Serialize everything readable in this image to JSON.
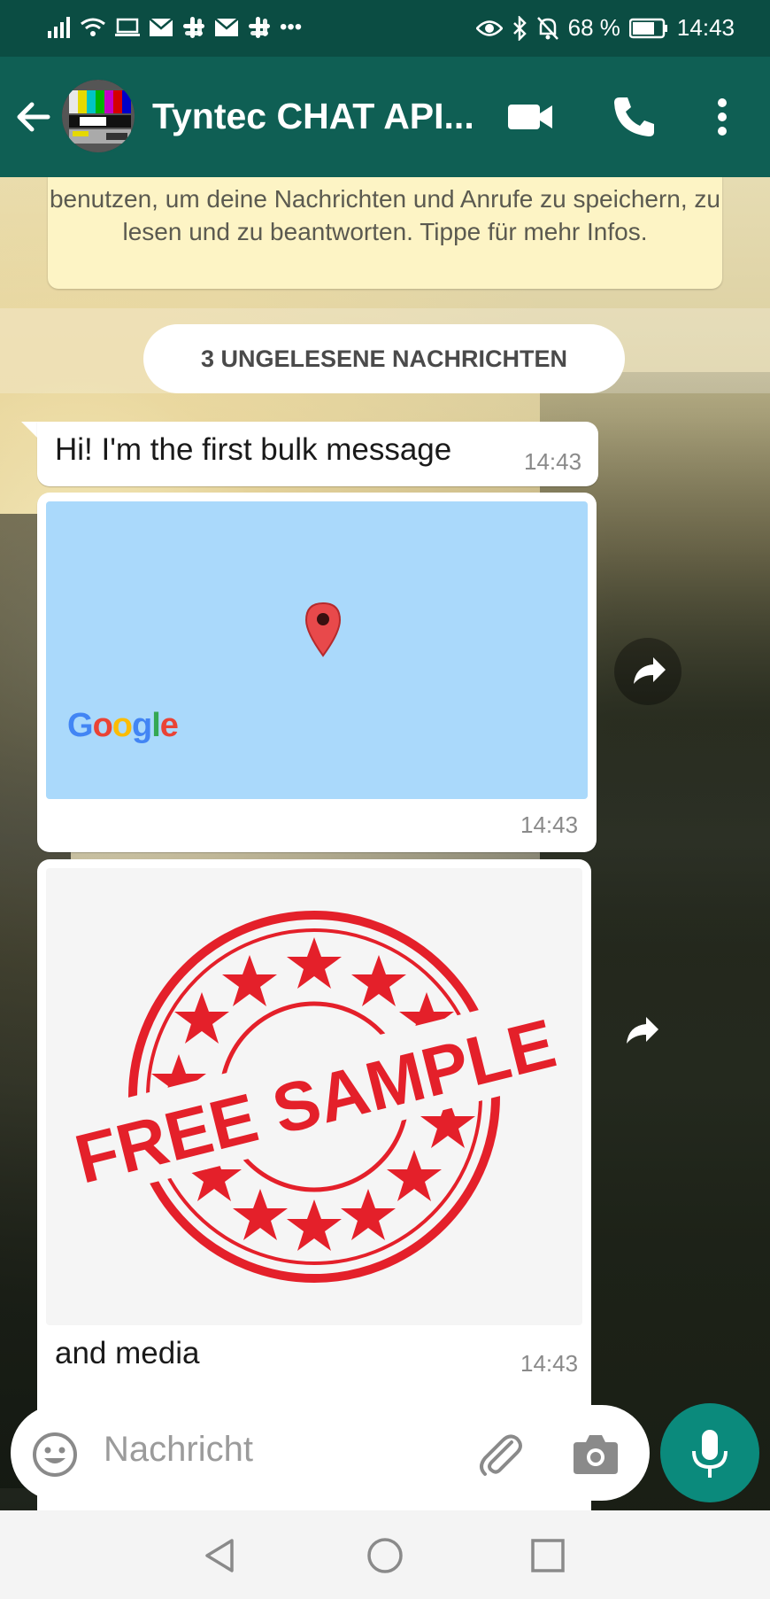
{
  "status_bar": {
    "battery": "68 %",
    "time": "14:43"
  },
  "header": {
    "title": "Tyntec CHAT API...",
    "back_icon": "arrow-left-icon",
    "video_icon": "video-call-icon",
    "phone_icon": "phone-icon",
    "menu_icon": "more-vertical-icon"
  },
  "chat": {
    "encryption_note": "benutzen, um deine Nachrichten und Anrufe zu speichern, zu lesen und zu beantworten. Tippe für mehr Infos.",
    "unread_label": "3 UNGELESENE NACHRICHTEN",
    "messages": [
      {
        "type": "text",
        "text": "Hi! I'm the first bulk message",
        "time": "14:43"
      },
      {
        "type": "location",
        "map_logo": "Google",
        "time": "14:43"
      },
      {
        "type": "image",
        "image_text": "FREE SAMPLE",
        "caption": "and media",
        "time": "14:43"
      }
    ]
  },
  "composer": {
    "placeholder": "Nachricht",
    "emoji_icon": "emoji-icon",
    "attach_icon": "paperclip-icon",
    "camera_icon": "camera-icon",
    "mic_icon": "microphone-icon"
  },
  "colors": {
    "header": "#0f5f54",
    "accent": "#0b8a7c",
    "map": "#aad9fb",
    "stamp_red": "#e4202a"
  }
}
